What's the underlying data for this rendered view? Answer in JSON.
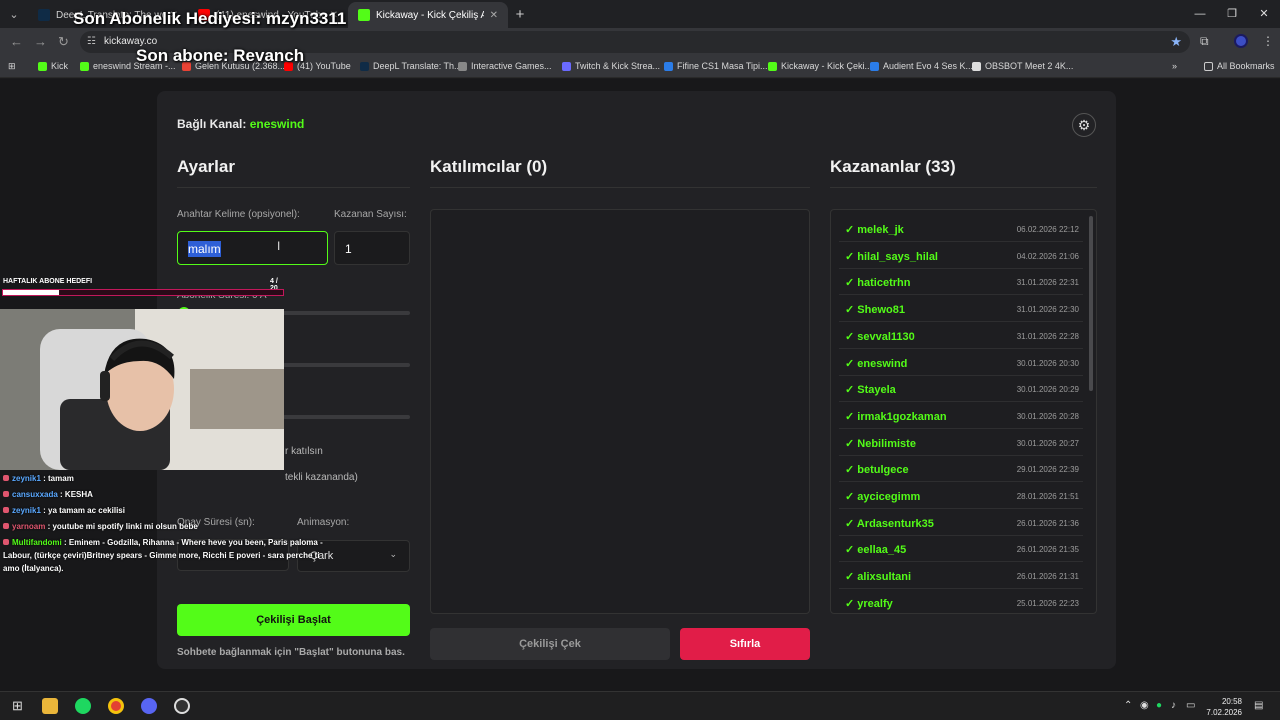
{
  "browser": {
    "tabs": [
      {
        "title": "DeepL Translate: The world's m",
        "active": false
      },
      {
        "title": "(41) eneswind - YouTube",
        "active": false
      },
      {
        "title": "Kickaway - Kick Çekiliş Aracı",
        "active": true
      }
    ],
    "url": "kickaway.co",
    "bookmarks": [
      "Kick",
      "eneswind Stream -...",
      "Gelen Kutusu (2.368...",
      "(41) YouTube",
      "DeepL Translate: Th...",
      "Interactive Games...",
      "Twitch & Kick Strea...",
      "Fifine CS1 Masa Tipi...",
      "Kickaway - Kick Çeki...",
      "Audient Evo 4 Ses K...",
      "OBSBOT Meet 2 4K...",
      "All Bookmarks"
    ]
  },
  "header": {
    "channel_label": "Bağlı Kanal:",
    "channel_name": "eneswind"
  },
  "settings": {
    "title": "Ayarlar",
    "keyword_label": "Anahtar Kelime (opsiyonel):",
    "keyword_value": "malım",
    "winner_count_label": "Kazanan Sayısı:",
    "winner_count_value": "1",
    "sub_duration_label": "Abonelik Süresi: 0 A",
    "participate_text": "r katılsın",
    "multi_winner_text": "tekli kazananda)",
    "confirm_label": "Onay Süresi (sn):",
    "animation_label": "Animasyon:",
    "animation_value": "Çark",
    "start_button": "Çekilişi Başlat",
    "hint": "Sohbete bağlanmak için \"Başlat\" butonuna bas."
  },
  "participants": {
    "title": "Katılımcılar (0)",
    "draw_button": "Çekilişi Çek",
    "reset_button": "Sıfırla"
  },
  "winners": {
    "title": "Kazananlar (33)",
    "list": [
      {
        "name": "✓ melek_jk",
        "date": "06.02.2026 22:12"
      },
      {
        "name": "✓ hilal_says_hilal",
        "date": "04.02.2026 21:06"
      },
      {
        "name": "✓ haticetrhn",
        "date": "31.01.2026 22:31"
      },
      {
        "name": "✓ Shewo81",
        "date": "31.01.2026 22:30"
      },
      {
        "name": "✓ sevval1130",
        "date": "31.01.2026 22:28"
      },
      {
        "name": "✓ eneswind",
        "date": "30.01.2026 20:30"
      },
      {
        "name": "✓ Stayela",
        "date": "30.01.2026 20:29"
      },
      {
        "name": "✓ irmak1gozkaman",
        "date": "30.01.2026 20:28"
      },
      {
        "name": "✓ Nebilimiste",
        "date": "30.01.2026 20:27"
      },
      {
        "name": "✓ betulgece",
        "date": "29.01.2026 22:39"
      },
      {
        "name": "✓ aycicegimm",
        "date": "28.01.2026 21:51"
      },
      {
        "name": "✓ Ardasenturk35",
        "date": "26.01.2026 21:36"
      },
      {
        "name": "✓ eellaa_45",
        "date": "26.01.2026 21:35"
      },
      {
        "name": "✓ alixsultani",
        "date": "26.01.2026 21:31"
      },
      {
        "name": "✓ yrealfy",
        "date": "25.01.2026 22:23"
      }
    ]
  },
  "overlay": {
    "gift_title": "Son Abonelik Hediyesi: mzyn3311",
    "last_sub": "Son abone: Revanch",
    "goal_label": "HAFTALIK ABONE HEDEFI",
    "goal_count": "4 / 20",
    "goal_progress": 0.2,
    "chat": [
      {
        "user": "zeynik1",
        "msg": " : tamam",
        "color": "#5aa8ff"
      },
      {
        "user": "cansuxxada",
        "msg": " : KESHA",
        "color": "#5aa8ff"
      },
      {
        "user": "zeynik1",
        "msg": " : ya tamam ac cekilisi",
        "color": "#5aa8ff"
      },
      {
        "user": "yarnoam",
        "msg": " : youtube mi spotify linki mi olsun bebe",
        "color": "#e0566f"
      },
      {
        "user": "Multifandomi",
        "msg": " : Eminem - Godzilla, Rihanna - Where heve you been, Paris paloma - Labour, (türkçe çeviri)Britney spears - Gimme more, Ricchi E poveri - sara perche ti amo (İtalyanca).",
        "color": "#53fc18"
      }
    ]
  },
  "taskbar": {
    "time": "20:58",
    "date": "7.02.2026"
  },
  "colors": {
    "accent": "#53fc18",
    "danger": "#e11d48",
    "card": "#222225"
  }
}
